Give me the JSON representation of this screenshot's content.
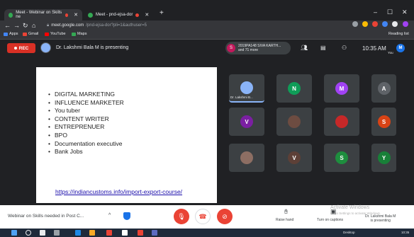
{
  "browser": {
    "tabs": [
      {
        "title": "Meet - Webinar on Skills ne"
      },
      {
        "title": "Meet - pnd-ejsa-dor"
      }
    ],
    "new_tab_symbol": "+",
    "url": "meet.google.com",
    "url_path": "/pnd-ejsa-dor?pli=1&authuser=5",
    "bookmarks": [
      {
        "label": "Apps",
        "color": "#4285f4"
      },
      {
        "label": "Gmail",
        "color": "#ea4335"
      },
      {
        "label": "YouTube",
        "color": "#ff0000"
      },
      {
        "label": "Maps",
        "color": "#34a853"
      }
    ],
    "reading_list": "Reading list"
  },
  "meet": {
    "rec_label": "REC",
    "presenting_text": "Dr. Lakshmi Bala M is presenting",
    "participant_chip": {
      "initial": "S",
      "line1": "2019PA148 SIVA KARTH...",
      "line2": "and 71 more"
    },
    "clock": "10:35 AM",
    "you_initial": "M",
    "you_label": "You",
    "meeting_title": "Webinar on Skills needed in Post C...",
    "raise_hand_label": "Raise hand",
    "captions_label": "Turn on captions",
    "presenting_badge_1": "Dr. Lakshmi Bala M",
    "presenting_badge_2": "is presenting"
  },
  "slide": {
    "bullets": [
      "DIGITAL MARKETING",
      "INFLUENCE MARKETER",
      "You tuber",
      "CONTENT WRITER",
      "ENTREPRENUER",
      "BPO",
      "Documentation executive",
      "Bank Jobs"
    ],
    "link": "https://indiancustoms.info/import-export-course/"
  },
  "tiles": [
    {
      "initial": "",
      "name": "Dr. Lakshmi B...",
      "color": "#8ab4f8",
      "photo": true
    },
    {
      "initial": "N",
      "name": "",
      "color": "#0f9d58",
      "photo": false
    },
    {
      "initial": "M",
      "name": "",
      "color": "#a142f4",
      "photo": false
    },
    {
      "initial": "A",
      "name": "",
      "color": "#5f6368",
      "photo": false
    },
    {
      "initial": "V",
      "name": "",
      "color": "#7b1fa2",
      "photo": false
    },
    {
      "initial": "",
      "name": "",
      "color": "#6d4c41",
      "photo": true
    },
    {
      "initial": "",
      "name": "",
      "color": "#c62828",
      "photo": true
    },
    {
      "initial": "S",
      "name": "",
      "color": "#d84315",
      "photo": false
    },
    {
      "initial": "",
      "name": "",
      "color": "#8d6e63",
      "photo": true
    },
    {
      "initial": "V",
      "name": "",
      "color": "#5d4037",
      "photo": false
    },
    {
      "initial": "S",
      "name": "",
      "color": "#1e8e3e",
      "photo": false
    },
    {
      "initial": "Y",
      "name": "",
      "color": "#188038",
      "photo": false
    }
  ],
  "watermark": {
    "title": "Activate Windows",
    "subtitle": "Go to Settings to activate Windows."
  },
  "taskbar": {
    "desktop_label": "Desktop",
    "time": "10:35"
  },
  "colors": {
    "accent": "#1a73e8",
    "danger": "#ea4335",
    "bg_dark": "#202124"
  }
}
